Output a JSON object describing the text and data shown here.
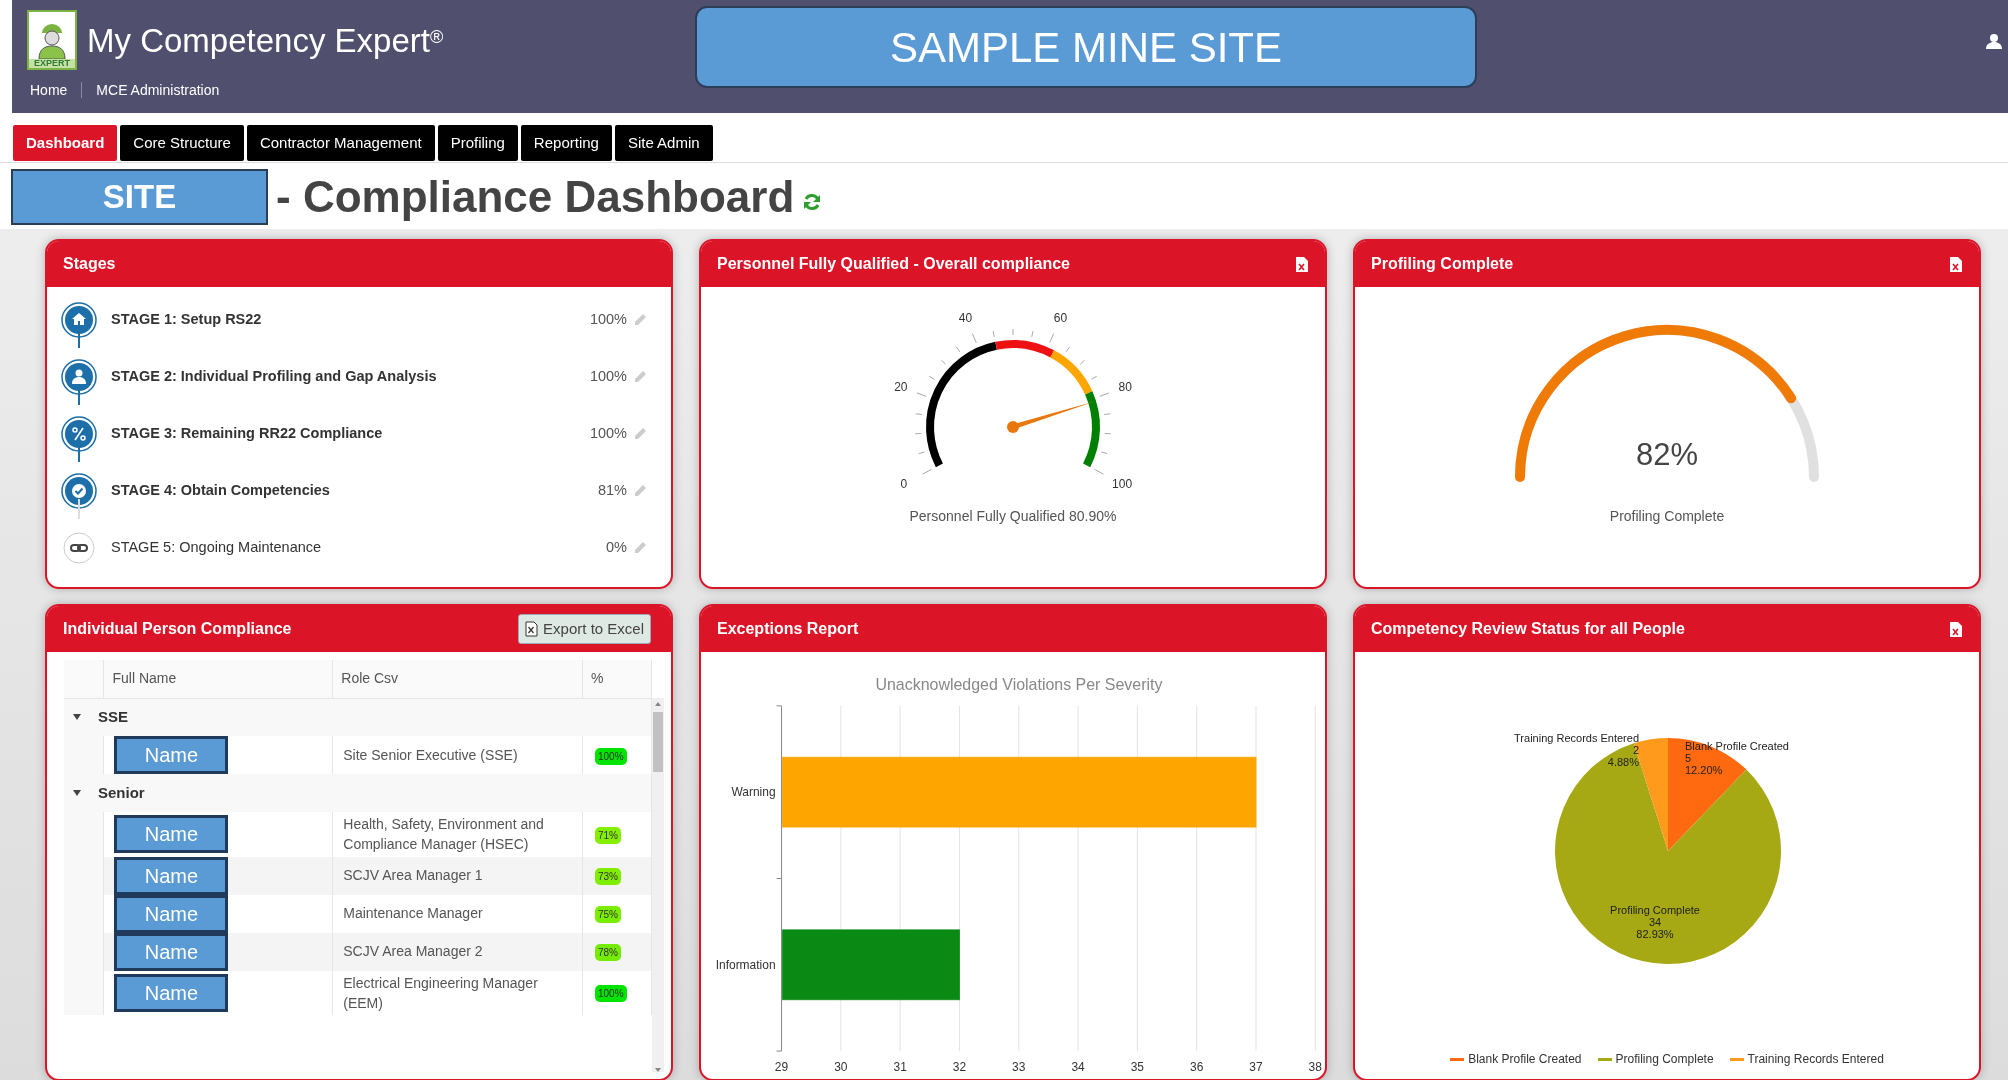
{
  "header": {
    "logo_text": "EXPERT",
    "app_title": "My Competency Expert$^{®}$",
    "nav_links": [
      "Home",
      "MCE Administration"
    ],
    "site_banner": "SAMPLE MINE SITE"
  },
  "tabs": [
    {
      "label": "Dashboard",
      "selected": true
    },
    {
      "label": "Core Structure",
      "selected": false
    },
    {
      "label": "Contractor Management",
      "selected": false
    },
    {
      "label": "Profiling",
      "selected": false
    },
    {
      "label": "Reporting",
      "selected": false
    },
    {
      "label": "Site Admin",
      "selected": false
    }
  ],
  "page_title": {
    "site_label": "SITE",
    "title": "- Compliance Dashboard"
  },
  "stages": {
    "title": "Stages",
    "items": [
      {
        "label": "STAGE 1: Setup RS22",
        "percent": "100%",
        "completed": true
      },
      {
        "label": "STAGE 2: Individual Profiling and Gap Analysis",
        "percent": "100%",
        "completed": true
      },
      {
        "label": "STAGE 3: Remaining RR22 Compliance",
        "percent": "100%",
        "completed": true
      },
      {
        "label": "STAGE 4: Obtain Competencies",
        "percent": "81%",
        "completed": true
      },
      {
        "label": "STAGE 5: Ongoing Maintenance",
        "percent": "0%",
        "completed": false
      }
    ]
  },
  "compliance_gauge": {
    "title": "Personnel Fully Qualified - Overall compliance",
    "ticks": [
      "0",
      "20",
      "40",
      "60",
      "80",
      "100"
    ],
    "caption": "Personnel Fully Qualified 80.90%"
  },
  "profiling": {
    "title": "Profiling Complete",
    "value": "82%",
    "caption": "Profiling Complete"
  },
  "person_compliance": {
    "title": "Individual Person Compliance",
    "export_button": "Export to Excel",
    "columns": [
      "Full Name",
      "Role Csv",
      "%"
    ],
    "groups": [
      {
        "name": "SSE",
        "expanded": true,
        "rows": [
          {
            "name": "Name",
            "role": "Site Senior Executive (SSE)",
            "percent": "100%",
            "color": "#00e400"
          }
        ]
      },
      {
        "name": "Senior",
        "expanded": true,
        "rows": [
          {
            "name": "Name",
            "role": "Health, Safety, Environment and Compliance Manager (HSEC)",
            "percent": "71%",
            "color": "#84ef00"
          },
          {
            "name": "Name",
            "role": "SCJV Area Manager 1",
            "percent": "73%",
            "color": "#7fee00"
          },
          {
            "name": "Name",
            "role": "Maintenance Manager",
            "percent": "75%",
            "color": "#7aee00"
          },
          {
            "name": "Name",
            "role": "SCJV Area Manager 2",
            "percent": "78%",
            "color": "#74ec00"
          },
          {
            "name": "Name",
            "role": "Electrical Engineering Manager (EEM)",
            "percent": "100%",
            "color": "#00e400"
          }
        ]
      }
    ]
  },
  "exceptions": {
    "title": "Exceptions Report",
    "chart_data": {
      "type": "bar",
      "orientation": "horizontal",
      "stacked": true,
      "grid": true,
      "title": "Unacknowledged Violations Per Severity",
      "categories": [
        "Warning",
        "Information"
      ],
      "series": [
        {
          "color": "#ffa500",
          "values": [
            37,
            null
          ]
        },
        {
          "color": "#0a8a14",
          "values": [
            null,
            32
          ]
        }
      ],
      "xlim": [
        29,
        38
      ],
      "xticks": [
        29,
        30,
        31,
        32,
        33,
        34,
        35,
        36,
        37,
        38
      ]
    }
  },
  "review_status": {
    "title": "Competency Review Status for all People",
    "chart_data": {
      "type": "pie",
      "data_labels": true,
      "categories": [
        "Blank Profile Created",
        "Profiling Complete",
        "Training Records Entered"
      ],
      "values": [
        12.2,
        82.93,
        4.88
      ],
      "value_labels": [
        [
          "5",
          "12.20%"
        ],
        [
          "34",
          "82.93%"
        ],
        [
          "2",
          "4.88%"
        ]
      ]
    },
    "legend": [
      {
        "label": "Blank Profile Created",
        "color": "#ff6a10"
      },
      {
        "label": "Profiling Complete",
        "color": "#a6a814"
      },
      {
        "label": "Training Records Entered",
        "color": "#ff9a1c"
      }
    ]
  }
}
